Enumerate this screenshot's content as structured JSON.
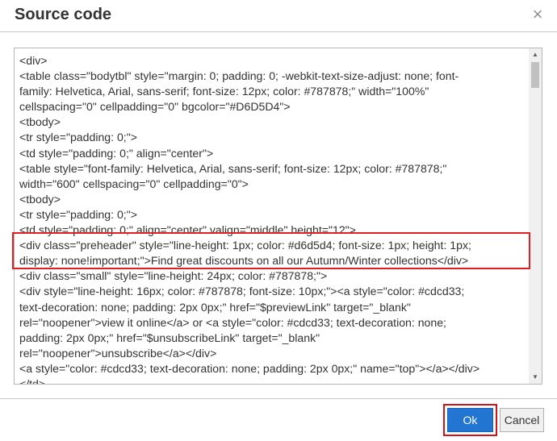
{
  "dialog": {
    "title": "Source code",
    "close_icon": "close-icon",
    "close_glyph": "×"
  },
  "editor": {
    "lines": [
      "<div>",
      "<table class=\"bodytbl\" style=\"margin: 0; padding: 0; -webkit-text-size-adjust: none; font-",
      "family: Helvetica, Arial, sans-serif; font-size: 12px; color: #787878;\" width=\"100%\"",
      "cellspacing=\"0\" cellpadding=\"0\" bgcolor=\"#D6D5D4\">",
      "<tbody>",
      "<tr style=\"padding: 0;\">",
      "<td style=\"padding: 0;\" align=\"center\">",
      "<table style=\"font-family: Helvetica, Arial, sans-serif; font-size: 12px; color: #787878;\"",
      "width=\"600\" cellspacing=\"0\" cellpadding=\"0\">",
      "<tbody>",
      "<tr style=\"padding: 0;\">",
      "<td style=\"padding: 0;\" align=\"center\" valign=\"middle\" height=\"12\">",
      "<div class=\"preheader\" style=\"line-height: 1px; color: #d6d5d4; font-size: 1px; height: 1px;",
      "display: none!important;\">Find great discounts on all our Autumn/Winter collections</div>",
      "<div class=\"small\" style=\"line-height: 24px; color: #787878;\">",
      "<div style=\"line-height: 16px; color: #787878; font-size: 10px;\"><a style=\"color: #cdcd33;",
      "text-decoration: none; padding: 2px 0px;\" href=\"$previewLink\" target=\"_blank\"",
      "rel=\"noopener\">view it online</a> or <a style=\"color: #cdcd33; text-decoration: none;",
      "padding: 2px 0px;\" href=\"$unsubscribeLink\" target=\"_blank\"",
      "rel=\"noopener\">unsubscribe</a></div>",
      "<a style=\"color: #cdcd33; text-decoration: none; padding: 2px 0px;\" name=\"top\"></a></div>",
      "</td>"
    ],
    "scroll_up_icon": "scroll-up-icon",
    "scroll_down_icon": "scroll-down-icon"
  },
  "footer": {
    "ok_label": "Ok",
    "cancel_label": "Cancel"
  },
  "colors": {
    "ok_bg": "#2276d2",
    "highlight": "#e02020",
    "text": "#333333"
  }
}
